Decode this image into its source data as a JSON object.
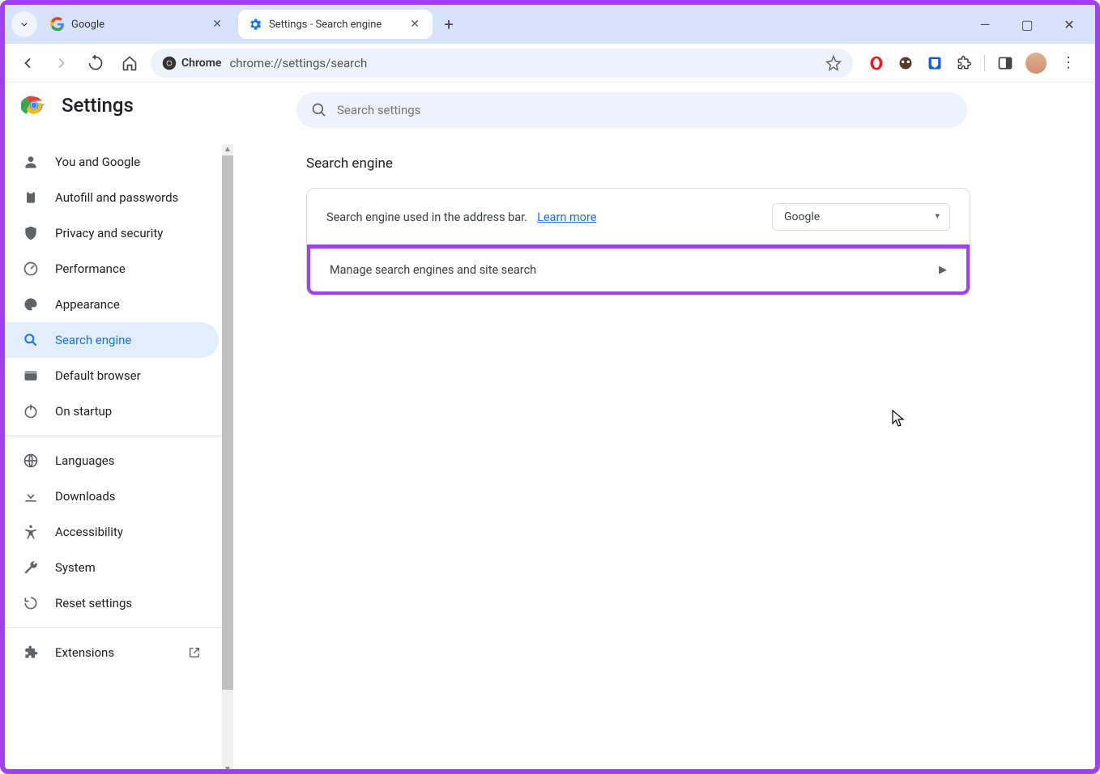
{
  "tabs": {
    "items": [
      {
        "title": "Google",
        "active": false
      },
      {
        "title": "Settings - Search engine",
        "active": true
      }
    ]
  },
  "omnibox": {
    "chip_label": "Chrome",
    "url": "chrome://settings/search"
  },
  "settings": {
    "title": "Settings",
    "search_placeholder": "Search settings"
  },
  "sidebar": {
    "items": [
      {
        "label": "You and Google"
      },
      {
        "label": "Autofill and passwords"
      },
      {
        "label": "Privacy and security"
      },
      {
        "label": "Performance"
      },
      {
        "label": "Appearance"
      },
      {
        "label": "Search engine"
      },
      {
        "label": "Default browser"
      },
      {
        "label": "On startup"
      }
    ],
    "items2": [
      {
        "label": "Languages"
      },
      {
        "label": "Downloads"
      },
      {
        "label": "Accessibility"
      },
      {
        "label": "System"
      },
      {
        "label": "Reset settings"
      }
    ],
    "extensions_label": "Extensions"
  },
  "main": {
    "section_title": "Search engine",
    "row1_text": "Search engine used in the address bar.",
    "learn_more": "Learn more",
    "selected_engine": "Google",
    "row2_text": "Manage search engines and site search"
  }
}
